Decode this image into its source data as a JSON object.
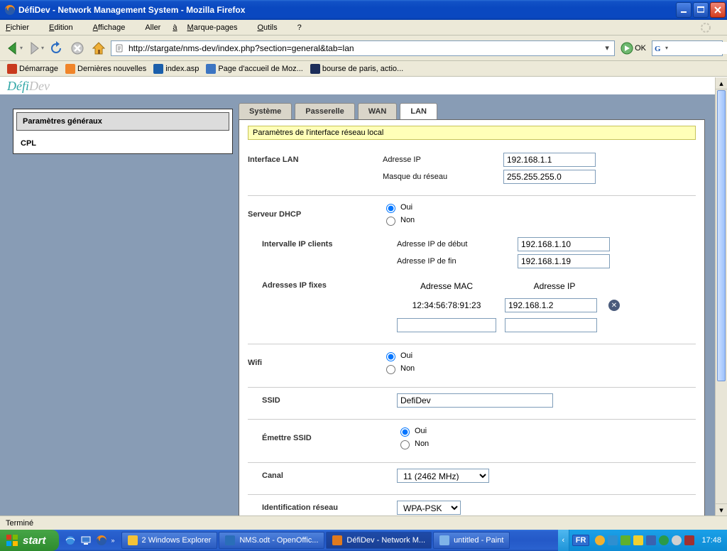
{
  "window": {
    "title": "DéfiDev - Network Management System - Mozilla Firefox"
  },
  "menu": {
    "file": "Fichier",
    "edit": "Edition",
    "view": "Affichage",
    "go": "Aller à",
    "bookmarks": "Marque-pages",
    "tools": "Outils",
    "help": "?"
  },
  "url": "http://stargate/nms-dev/index.php?section=general&tab=lan",
  "go_label": "OK",
  "bookmark_items": [
    {
      "label": "Démarrage",
      "color": "#c93a1e"
    },
    {
      "label": "Dernières nouvelles",
      "color": "#f0852a"
    },
    {
      "label": "index.asp",
      "color": "#1b5fab"
    },
    {
      "label": "Page d'accueil de Moz...",
      "color": "#3c75c2"
    },
    {
      "label": "bourse de paris, actio...",
      "color": "#1c2d5a"
    }
  ],
  "logo": {
    "part1": "Défi",
    "part2": "Dev"
  },
  "sidebar": {
    "items": [
      "Paramètres généraux",
      "CPL"
    ],
    "selected_index": 0
  },
  "tabs": [
    "Système",
    "Passerelle",
    "WAN",
    "LAN"
  ],
  "active_tab_index": 3,
  "notice": "Paramètres de l'interface réseau local",
  "lan": {
    "heading": "Interface LAN",
    "ip_label": "Adresse IP",
    "ip_value": "192.168.1.1",
    "mask_label": "Masque du réseau",
    "mask_value": "255.255.255.0"
  },
  "dhcp": {
    "heading": "Serveur DHCP",
    "yes": "Oui",
    "no": "Non",
    "selected": "yes",
    "range_heading": "Intervalle IP clients",
    "start_label": "Adresse IP de début",
    "start_value": "192.168.1.10",
    "end_label": "Adresse IP de fin",
    "end_value": "192.168.1.19",
    "fixed_heading": "Adresses IP fixes",
    "mac_col": "Adresse MAC",
    "ip_col": "Adresse IP",
    "rows": [
      {
        "mac": "12:34:56:78:91:23",
        "ip": "192.168.1.2"
      },
      {
        "mac": "",
        "ip": ""
      }
    ]
  },
  "wifi": {
    "heading": "Wifi",
    "yes": "Oui",
    "no": "Non",
    "selected": "yes",
    "ssid_label": "SSID",
    "ssid_value": "DefiDev",
    "broadcast_label": "Émettre SSID",
    "broadcast_yes": "Oui",
    "broadcast_no": "Non",
    "broadcast_selected": "yes",
    "channel_label": "Canal",
    "channel_value": "11 (2462 MHz)",
    "auth_label": "Identification réseau",
    "auth_value": "WPA-PSK"
  },
  "status_text": "Terminé",
  "taskbar": {
    "start": "start",
    "items": [
      {
        "label": "2 Windows Explorer",
        "color": "#f3c238"
      },
      {
        "label": "NMS.odt - OpenOffic...",
        "color": "#2a6eb8"
      },
      {
        "label": "DéfiDev - Network M...",
        "color": "#e07a1e",
        "active": true
      },
      {
        "label": "untitled - Paint",
        "color": "#7fb4e8"
      }
    ],
    "lang": "FR",
    "clock": "17:48"
  }
}
